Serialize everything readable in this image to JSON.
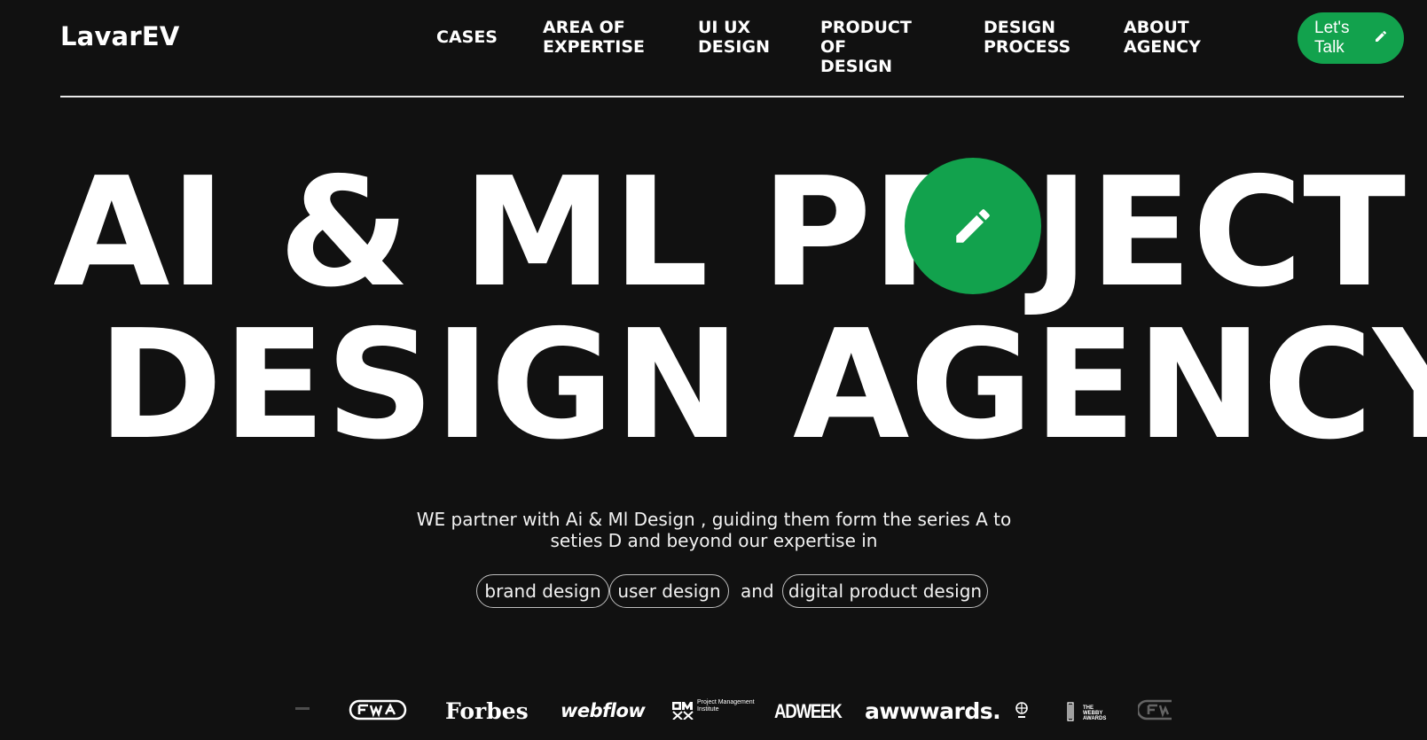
{
  "header": {
    "logo": "LavarEV",
    "nav": [
      {
        "label": "CASES"
      },
      {
        "label": "AREA OF EXPERTISE"
      },
      {
        "label": "UI UX DESIGN"
      },
      {
        "label": "PRODUCT OF DESIGN"
      },
      {
        "label": "DESIGN PROCESS"
      },
      {
        "label": "ABOUT AGENCY"
      }
    ],
    "cta_label": "Let's Talk",
    "cta_icon": "pencil-icon"
  },
  "hero": {
    "line1_left": "AI & ML PR",
    "line1_right": "JECT",
    "line2": "DESIGN AGENCY",
    "badge_icon": "pencil-icon",
    "badge_color": "#12a24d"
  },
  "intro": {
    "text": "WE partner with Ai & Ml Design , guiding them form the series A to seties D and beyond our expertise in",
    "pills": [
      "brand design",
      "user design",
      "digital product design"
    ],
    "connector": "and"
  },
  "logos": {
    "items": [
      "FWA",
      "Forbes",
      "webflow",
      "PMI Project Management Institute",
      "ADWEEK",
      "awwwards.",
      "Webby Awards"
    ],
    "forbes": "Forbes",
    "webflow": "webflow",
    "pmi": "Project Management Institute",
    "adweek": "ADWEEK",
    "awwwards": "awwwards.",
    "webby": "THE WEBBY AWARDS"
  },
  "colors": {
    "background": "#111111",
    "accent": "#12a24d",
    "text": "#ffffff"
  }
}
